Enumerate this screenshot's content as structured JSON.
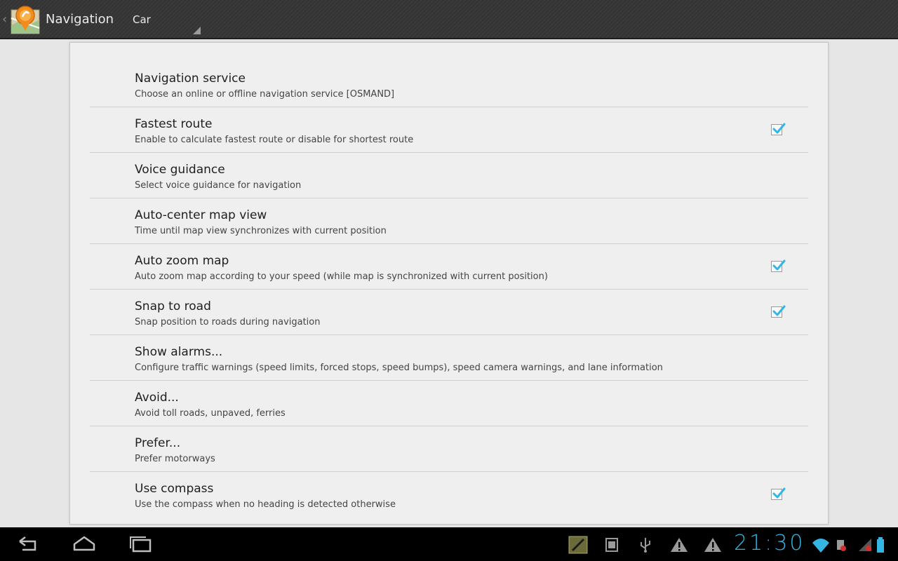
{
  "actionbar": {
    "title": "Navigation",
    "profile": "Car"
  },
  "preferences": [
    {
      "title": "Navigation service",
      "summary": "Choose an online or offline navigation service  [OSMAND]",
      "checkbox": false
    },
    {
      "title": "Fastest route",
      "summary": "Enable to calculate fastest route or disable for shortest route",
      "checkbox": true,
      "checked": true
    },
    {
      "title": "Voice guidance",
      "summary": "Select voice guidance for navigation",
      "checkbox": false
    },
    {
      "title": "Auto-center map view",
      "summary": "Time until map view synchronizes with current position",
      "checkbox": false
    },
    {
      "title": "Auto zoom map",
      "summary": "Auto zoom map according to your speed (while map is synchronized with current position)",
      "checkbox": true,
      "checked": true
    },
    {
      "title": "Snap to road",
      "summary": "Snap position to roads during navigation",
      "checkbox": true,
      "checked": true
    },
    {
      "title": "Show alarms...",
      "summary": "Configure traffic warnings (speed limits, forced stops, speed bumps), speed camera warnings, and lane information",
      "checkbox": false
    },
    {
      "title": "Avoid...",
      "summary": "Avoid toll roads, unpaved, ferries",
      "checkbox": false
    },
    {
      "title": "Prefer...",
      "summary": "Prefer motorways",
      "checkbox": false
    },
    {
      "title": "Use compass",
      "summary": "Use the compass when no heading is detected otherwise",
      "checkbox": true,
      "checked": true
    }
  ],
  "systembar": {
    "clock": "21:30",
    "accent_color": "#33b5e5",
    "nav_icons": [
      "back-icon",
      "home-icon",
      "recent-apps-icon"
    ],
    "status_icons": [
      "notes-app-icon",
      "sd-card-icon",
      "usb-icon",
      "warning-icon",
      "warning-icon",
      "wifi-icon",
      "gps-off-icon",
      "no-sim-icon",
      "battery-icon"
    ]
  }
}
